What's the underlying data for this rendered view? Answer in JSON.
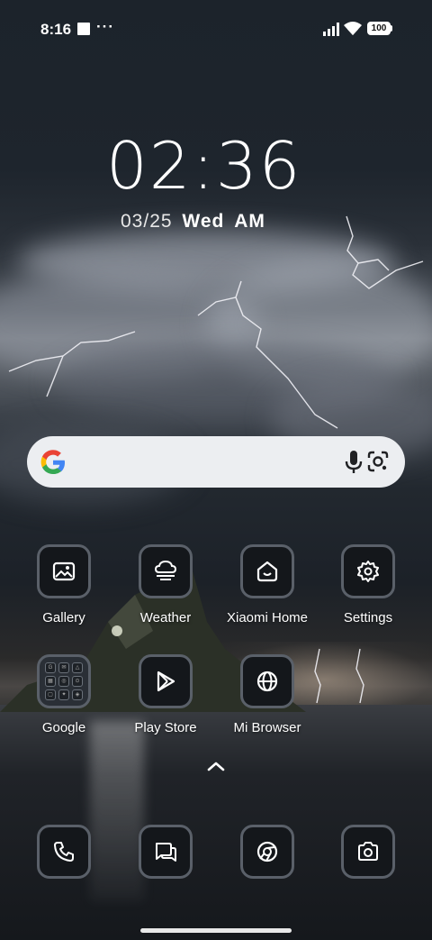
{
  "status_bar": {
    "time": "8:16",
    "notification_dots": "···",
    "battery_level": "100"
  },
  "clock": {
    "time": "02:36",
    "date": "03/25",
    "weekday": "Wed",
    "meridiem": "AM"
  },
  "search_bar": {
    "icons": [
      "google-g-icon",
      "microphone-icon",
      "google-lens-icon"
    ]
  },
  "apps_row1": [
    {
      "label": "Gallery",
      "icon": "gallery-icon"
    },
    {
      "label": "Weather",
      "icon": "weather-icon"
    },
    {
      "label": "Xiaomi Home",
      "icon": "xiaomi-home-icon"
    },
    {
      "label": "Settings",
      "icon": "gear-icon"
    }
  ],
  "apps_row2": [
    {
      "label": "Google",
      "icon": "folder-icon"
    },
    {
      "label": "Play Store",
      "icon": "play-store-icon"
    },
    {
      "label": "Mi Browser",
      "icon": "globe-icon"
    }
  ],
  "dock": [
    {
      "icon": "phone-icon"
    },
    {
      "icon": "messages-icon"
    },
    {
      "icon": "chrome-icon"
    },
    {
      "icon": "camera-icon"
    }
  ],
  "colors": {
    "tile_bg": "#14171b",
    "tile_border": "#5a6069",
    "search_bg": "#eceef1"
  }
}
